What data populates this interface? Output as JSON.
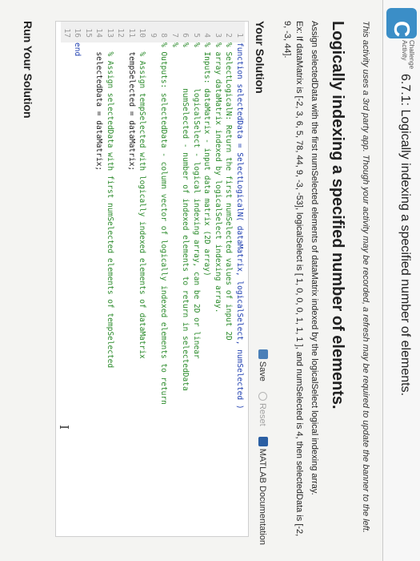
{
  "banner": {
    "brand_line1": "Challenge",
    "brand_line2": "Activity",
    "title": "6.7.1: Logically indexing a specified number of elements."
  },
  "notice": "This activity uses a 3rd party app. Though your activity may be recorded, a refresh may be required to update the banner to the left.",
  "heading": "Logically indexing a specified number of elements.",
  "description": "Assign selectedData with the first numSelected elements of dataMatrix indexed by the logicalSelect logical indexing array.",
  "example": "Ex: If dataMatrix is [-2, 3, 6, 5, 78, 44, 9, -3, -53], logicalSelect is [ 1, 0, 0, 0, 1, 1, 1 ], and numSelected is 4, then selectedData is [-2, 9, -3, 44].",
  "solution": {
    "title": "Your Solution",
    "save_label": "Save",
    "reset_label": "Reset",
    "docs_label": "MATLAB Documentation"
  },
  "code_lines": [
    {
      "n": "1",
      "text": "function selectedData = SelectLogicalN( dataMatrix, logicalSelect, numSelected )"
    },
    {
      "n": "2",
      "text": "% SelectLogicalN: Return the first numSelected values of input 2D"
    },
    {
      "n": "3",
      "text": "% array dataMatrix indexed by logicalSelect indexing array."
    },
    {
      "n": "4",
      "text": "% Inputs: dataMatrix - input data matrix (2D array)"
    },
    {
      "n": "5",
      "text": "%         logicalSelect - logical indexing array, can be 2D or linear"
    },
    {
      "n": "6",
      "text": "%         numSelected - number of indexed elements to return in selectedData"
    },
    {
      "n": "7",
      "text": "%"
    },
    {
      "n": "8",
      "text": "% Outputs: selectedData - column vector of logically indexed elements to return"
    },
    {
      "n": "9",
      "text": ""
    },
    {
      "n": "10",
      "text": "  % Assign tempSelected with logically indexed elements of dataMatrix"
    },
    {
      "n": "11",
      "text": "  tempSelected = dataMatrix;"
    },
    {
      "n": "12",
      "text": ""
    },
    {
      "n": "13",
      "text": "  % Assign selectedData with first numSelected elements of tempSelected"
    },
    {
      "n": "14",
      "text": "  selectedData = dataMatrix;"
    },
    {
      "n": "15",
      "text": ""
    },
    {
      "n": "16",
      "text": "end"
    },
    {
      "n": "17",
      "text": ""
    }
  ],
  "run_title": "Run Your Solution",
  "text_cursor": "I"
}
